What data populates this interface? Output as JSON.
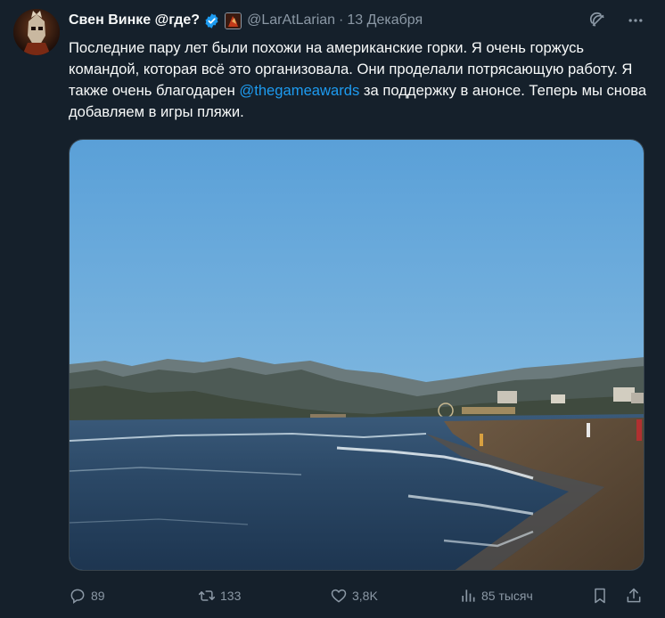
{
  "author": {
    "display_name": "Свен Винке @где?",
    "handle": "@LarAtLarian",
    "separator": "·",
    "date": "13 Декабря"
  },
  "tweet": {
    "text_before": "Последние пару лет были похожи на американские горки. Я очень горжусь командой, которая всё это организовала. Они проделали потрясающую работу. Я также очень благодарен ",
    "mention": "@thegameawards",
    "text_after": " за поддержку в анонсе. Теперь мы снова добавляем в игры пляжи."
  },
  "stats": {
    "replies": "89",
    "reposts": "133",
    "likes": "3,8K",
    "views": "85 тысяч"
  },
  "icons": {
    "verified": "verified-badge-icon",
    "grok": "grok-icon",
    "more": "more-options-icon",
    "reply": "reply-icon",
    "repost": "repost-icon",
    "like": "like-icon",
    "views": "views-icon",
    "bookmark": "bookmark-icon",
    "share": "share-icon"
  },
  "colors": {
    "background": "#15202b",
    "text": "#f7f9f9",
    "secondary": "#8b98a5",
    "accent": "#1d9bf0"
  }
}
